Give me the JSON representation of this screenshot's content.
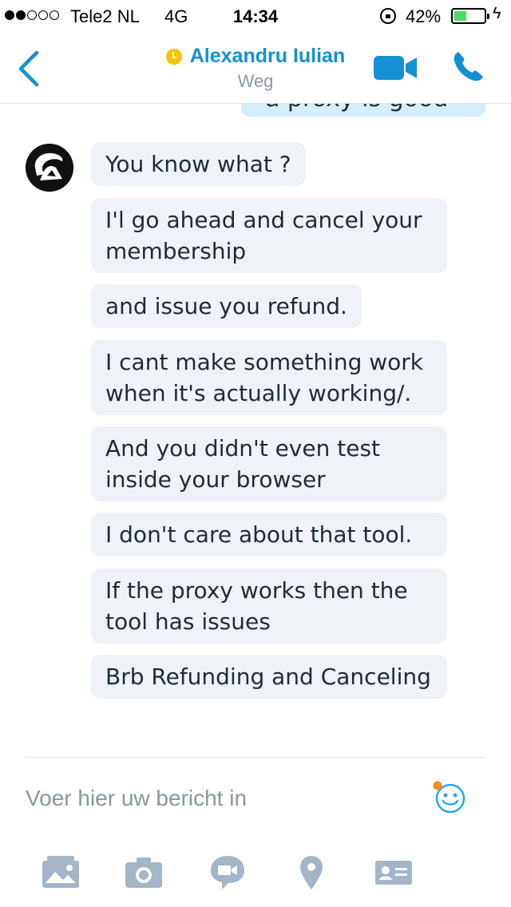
{
  "status_bar": {
    "carrier": "Tele2 NL",
    "network": "4G",
    "time": "14:34",
    "battery": "42%",
    "battery_level": 0.42,
    "signal_bars_filled": 2,
    "signal_bars_total": 5
  },
  "header": {
    "contact_name": "Alexandru Iulian",
    "status": "Weg",
    "accent_color": "#1590d2",
    "presence_color": "#f8c300",
    "icons": [
      "back-arrow-icon",
      "presence-away-icon",
      "video-call-icon",
      "phone-icon"
    ]
  },
  "chat": {
    "previous_fragment": "a proxy is good",
    "messages": [
      "You know what ?",
      "I'l go ahead and cancel your membership",
      "and issue you refund.",
      "I cant make something work when it's actually working/.",
      "And you didn't even test inside your browser",
      "I don't care about that tool.",
      "If the proxy works then the tool has issues",
      "Brb Refunding and Canceling"
    ],
    "incoming_bubble_color": "#eff2f7",
    "outgoing_bubble_color": "#d4eefb"
  },
  "composer": {
    "placeholder": "Voer hier uw bericht in",
    "icons": [
      "emoji-icon",
      "photo-gallery-icon",
      "camera-icon",
      "video-message-icon",
      "location-icon",
      "contact-card-icon"
    ]
  }
}
